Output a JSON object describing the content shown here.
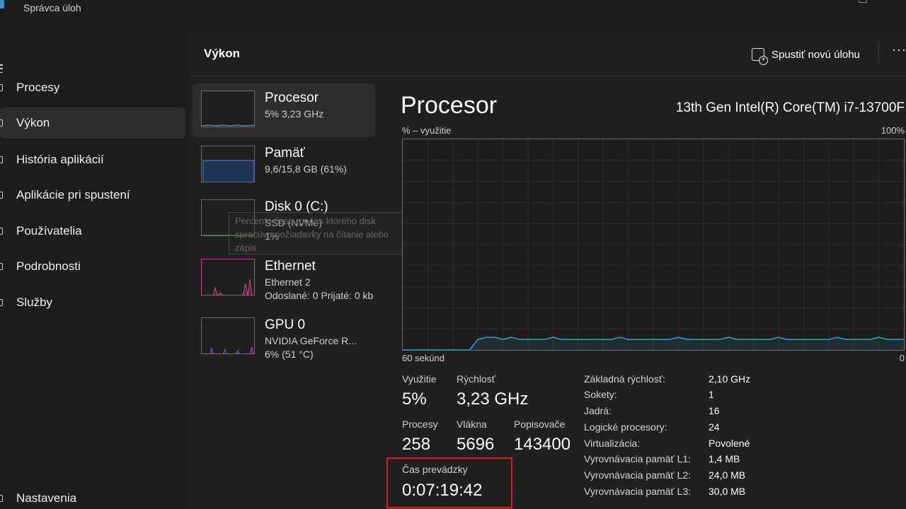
{
  "window": {
    "title": "Správca úloh"
  },
  "nav": {
    "items": [
      {
        "label": "Procesy"
      },
      {
        "label": "Výkon"
      },
      {
        "label": "História aplikácií"
      },
      {
        "label": "Aplikácie pri spustení"
      },
      {
        "label": "Používatelia"
      },
      {
        "label": "Podrobnosti"
      },
      {
        "label": "Služby"
      }
    ],
    "settings": "Nastavenia"
  },
  "header": {
    "title": "Výkon",
    "run_task": "Spustiť novú úlohu",
    "more": "···"
  },
  "tiles": [
    {
      "name": "Procesor",
      "line1": "5% 3,23 GHz",
      "line2": "",
      "color": "#2fa3c7"
    },
    {
      "name": "Pamäť",
      "line1": "9,6/15,8 GB (61%)",
      "line2": "",
      "color": "#4a78c2"
    },
    {
      "name": "Disk 0 (C:)",
      "line1": "SSD (NVMe)",
      "line2": "1%",
      "color": "#7bbf3f"
    },
    {
      "name": "Ethernet",
      "line1": "Ethernet 2",
      "line2": "Odoslané: 0 Prijaté: 0 kb",
      "color": "#c24a8a"
    },
    {
      "name": "GPU 0",
      "line1": "NVIDIA GeForce R...",
      "line2": "6% (51 °C)",
      "color": "#a04fc2"
    }
  ],
  "tooltip": {
    "text": "Percento času, počas ktorého disk spracúva požiadavky na čítanie alebo zápis"
  },
  "detail": {
    "title": "Procesor",
    "model": "13th Gen Intel(R) Core(TM) i7-13700F",
    "chart_ylabel": "% – využitie",
    "chart_ymax": "100%",
    "chart_xlabel": "60 sekúnd",
    "chart_xmin": "0",
    "line_color": "#2fa3c7",
    "stats": {
      "utilization_label": "Využitie",
      "utilization": "5%",
      "speed_label": "Rýchlosť",
      "speed": "3,23 GHz",
      "processes_label": "Procesy",
      "processes": "258",
      "threads_label": "Vlákna",
      "threads": "5696",
      "handles_label": "Popisovače",
      "handles": "143400",
      "uptime_label": "Čas prevádzky",
      "uptime": "0:07:19:42"
    },
    "specs": [
      {
        "label": "Základná rýchlosť:",
        "value": "2,10 GHz"
      },
      {
        "label": "Sokety:",
        "value": "1"
      },
      {
        "label": "Jadrá:",
        "value": "16"
      },
      {
        "label": "Logické procesory:",
        "value": "24"
      },
      {
        "label": "Virtualizácia:",
        "value": "Povolené"
      },
      {
        "label": "Vyrovnávacia pamäť L1:",
        "value": "1,4 MB"
      },
      {
        "label": "Vyrovnávacia pamäť L2:",
        "value": "24,0 MB"
      },
      {
        "label": "Vyrovnávacia pamäť L3:",
        "value": "30,0 MB"
      }
    ]
  },
  "chart_data": {
    "type": "line",
    "xlabel": "60 sekúnd",
    "ylabel": "% – využitie",
    "ylim": [
      0,
      100
    ],
    "xlim": [
      60,
      0
    ],
    "series": [
      {
        "values": [
          0,
          0,
          0,
          0,
          0,
          0,
          0,
          0,
          0,
          5,
          6,
          6,
          5,
          6,
          5,
          5,
          5,
          5,
          6,
          5,
          5,
          5,
          5,
          5,
          5,
          5,
          6,
          5,
          5,
          5,
          5,
          5,
          5,
          6,
          5,
          5,
          5,
          5,
          5,
          6,
          5,
          5,
          5,
          5,
          5,
          6,
          5,
          5,
          5,
          5,
          5,
          5,
          6,
          5,
          5,
          5,
          5,
          6,
          5,
          5,
          5
        ]
      }
    ]
  }
}
